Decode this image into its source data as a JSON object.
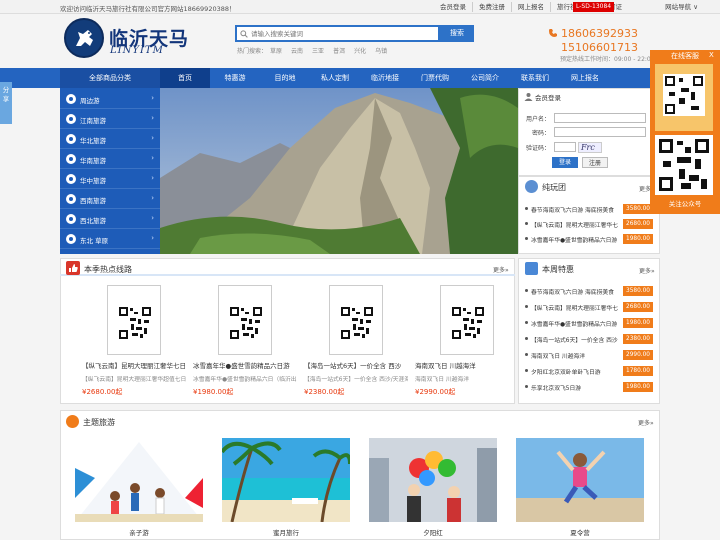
{
  "topbar": {
    "welcome": "欢迎访问临沂天马旅行社有限公司官方网站18669920388！",
    "links": [
      "会员登录",
      "免费注册",
      "网上报名",
      "旅行社业务经营许可证"
    ],
    "license": "L-SD-13084",
    "last_link": "网站导航 ∨"
  },
  "logo": {
    "cn": "临沂天马",
    "en": "LINYITM"
  },
  "search": {
    "placeholder": "请输入搜索关键词",
    "button": "搜索",
    "hot_label": "热门搜索：",
    "hot_terms": [
      "草原",
      "云南",
      "三亚",
      "普洱",
      "兴化",
      "乌镇"
    ]
  },
  "contact": {
    "phone1": "18606392933",
    "phone2": "15106601713",
    "hours": "预定热线工作时间：09:00 - 22:00"
  },
  "nav": {
    "all_label": "全部商品分类",
    "items": [
      "首页",
      "特惠游",
      "目的地",
      "私人定制",
      "临沂地接",
      "门票代购",
      "公司简介",
      "联系我们",
      "网上报名"
    ]
  },
  "sidebar": {
    "items": [
      "周边游",
      "江南旅游",
      "华北旅游",
      "华南旅游",
      "华中旅游",
      "西南旅游",
      "西北旅游",
      "东北 草原"
    ]
  },
  "share_tab": "分享",
  "login": {
    "title": "会员登录",
    "user_label": "用户名：",
    "pwd_label": "密码：",
    "code_label": "验证码：",
    "captcha": "Frc",
    "login_btn": "登录",
    "register_btn": "注册"
  },
  "tuan": {
    "title": "纯玩团",
    "more": "更多»",
    "deals": [
      {
        "name": "春节海南双飞六日游 海底捞美食",
        "price": "3580.00"
      },
      {
        "name": "【纵飞云南】昆明大理丽江奢华七日游",
        "price": "2680.00"
      },
      {
        "name": "冰雪嘉年华●盛世雪韵精品六日游",
        "price": "1980.00"
      }
    ]
  },
  "hot_routes": {
    "title": "本季热点线路",
    "more": "更多»",
    "cards": [
      {
        "title": "【纵飞云南】昆明大理丽江奢华七日游",
        "sub": "【纵飞云南】昆明大理丽江奢华超值七日游",
        "price": "¥2680.00起"
      },
      {
        "title": "冰雪嘉年华●盛世雪韵精品六日游",
        "sub": "冰雪嘉年华●盛世雪韵精品六日（临沂出发）",
        "price": "¥1980.00起"
      },
      {
        "title": "【海岛一站式6天】一价全含 西沙",
        "sub": "【海岛一站式6天】一价全含 西沙/天涯海角",
        "price": "¥2380.00起"
      },
      {
        "title": "海南双飞日 川越海洋",
        "sub": "海南双飞日 川越海洋",
        "price": "¥2990.00起"
      }
    ]
  },
  "weekly": {
    "title": "本周特惠",
    "more": "更多»",
    "deals": [
      {
        "name": "春节海南双飞六日游 海底捞美食",
        "price": "3580.00"
      },
      {
        "name": "【纵飞云南】昆明大理丽江奢华七日游",
        "price": "2680.00"
      },
      {
        "name": "冰雪嘉年华●盛世雪韵精品六日游",
        "price": "1980.00"
      },
      {
        "name": "【海岛一站式6天】一价全含 西沙",
        "price": "2380.00"
      },
      {
        "name": "海南双飞日 川越海洋",
        "price": "2990.00"
      },
      {
        "name": "夕阳红北京双卧单卧飞日游",
        "price": "1780.00"
      },
      {
        "name": "乐享北京双飞5日游",
        "price": "1980.00"
      }
    ]
  },
  "themes": {
    "title": "主题旅游",
    "more": "更多»",
    "items": [
      "亲子游",
      "蜜月旅行",
      "夕阳红",
      "夏令营"
    ]
  },
  "float_panel": {
    "title": "在线客服",
    "close": "X",
    "follow": "关注公众号"
  },
  "colors": {
    "nav": "#2464c0",
    "accent": "#f07c1a",
    "price": "#e8380d"
  }
}
